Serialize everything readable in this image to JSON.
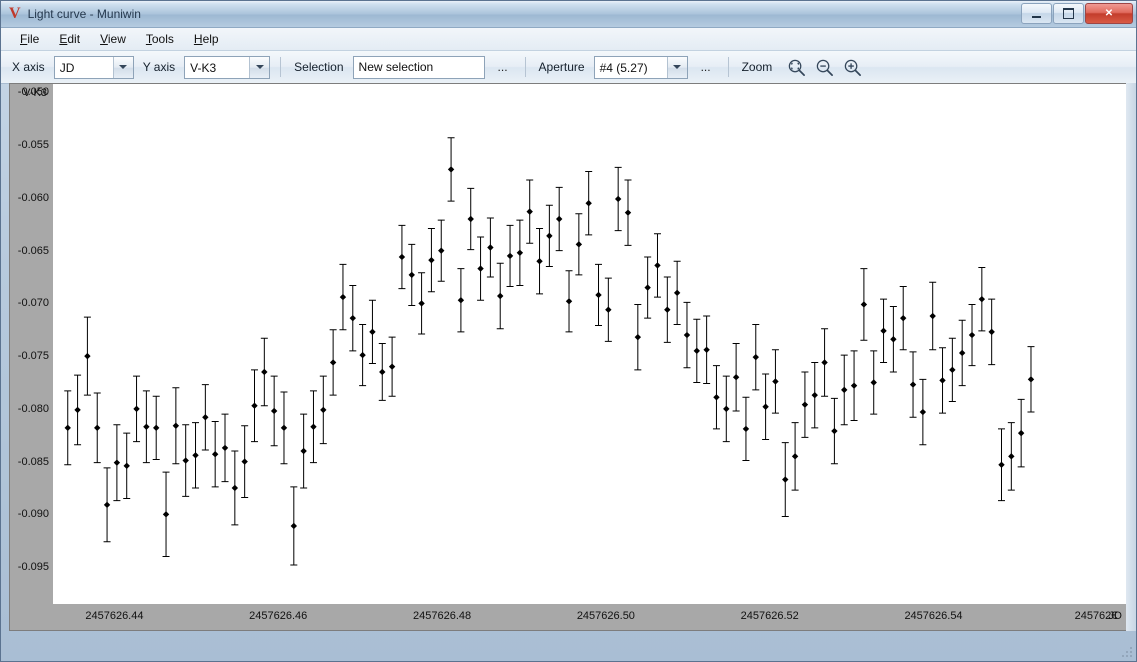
{
  "window": {
    "title": "Light curve - Muniwin",
    "logo": "V",
    "buttons": {
      "minimize": "minimize-button",
      "maximize": "maximize-button",
      "close": "✕"
    }
  },
  "menu": [
    {
      "label": "File",
      "accel": "F"
    },
    {
      "label": "Edit",
      "accel": "E"
    },
    {
      "label": "View",
      "accel": "V"
    },
    {
      "label": "Tools",
      "accel": "T"
    },
    {
      "label": "Help",
      "accel": "H"
    }
  ],
  "toolbar": {
    "x_axis_label": "X axis",
    "x_axis_value": "JD",
    "y_axis_label": "Y axis",
    "y_axis_value": "V-K3",
    "selection_label": "Selection",
    "selection_value": "New selection",
    "selection_more": "...",
    "aperture_label": "Aperture",
    "aperture_value": "#4 (5.27)",
    "aperture_more": "...",
    "zoom_label": "Zoom",
    "zoom_fit_icon": "zoom-fit-icon",
    "zoom_out_icon": "zoom-out-icon",
    "zoom_in_icon": "zoom-in-icon"
  },
  "chart_data": {
    "type": "scatter",
    "title": "",
    "xlabel": "JD",
    "ylabel": "V-K3",
    "grid": false,
    "legend": null,
    "xlim": [
      2457626.4325,
      2457626.5635
    ],
    "ylim": [
      -0.0985,
      -0.0492
    ],
    "y_axis_corner_label": "V-K3",
    "yticks": [
      -0.095,
      -0.09,
      -0.085,
      -0.08,
      -0.075,
      -0.07,
      -0.065,
      -0.06,
      -0.055,
      -0.05
    ],
    "ytick_labels": [
      "-0.095",
      "-0.090",
      "-0.085",
      "-0.080",
      "-0.075",
      "-0.070",
      "-0.065",
      "-0.060",
      "-0.055",
      "-0.050"
    ],
    "xticks": [
      2457626.44,
      2457626.46,
      2457626.48,
      2457626.5,
      2457626.52,
      2457626.54,
      2457626.56
    ],
    "xtick_labels": [
      "2457626.44",
      "2457626.46",
      "2457626.48",
      "2457626.50",
      "2457626.52",
      "2457626.54",
      "245762€"
    ],
    "marker": "diamond",
    "marker_color": "#000000",
    "errorbar_color": "#000000",
    "y_inverted": false,
    "points": [
      {
        "x": 2457626.4343,
        "y": -0.0818,
        "err": 0.0035
      },
      {
        "x": 2457626.4355,
        "y": -0.0801,
        "err": 0.0033
      },
      {
        "x": 2457626.4367,
        "y": -0.075,
        "err": 0.0037
      },
      {
        "x": 2457626.4379,
        "y": -0.0818,
        "err": 0.0033
      },
      {
        "x": 2457626.4391,
        "y": -0.0891,
        "err": 0.0035
      },
      {
        "x": 2457626.4403,
        "y": -0.0851,
        "err": 0.0036
      },
      {
        "x": 2457626.4415,
        "y": -0.0854,
        "err": 0.0031
      },
      {
        "x": 2457626.4427,
        "y": -0.08,
        "err": 0.0031
      },
      {
        "x": 2457626.4439,
        "y": -0.0817,
        "err": 0.0034
      },
      {
        "x": 2457626.4451,
        "y": -0.0818,
        "err": 0.003
      },
      {
        "x": 2457626.4463,
        "y": -0.09,
        "err": 0.004
      },
      {
        "x": 2457626.4475,
        "y": -0.0816,
        "err": 0.0036
      },
      {
        "x": 2457626.4487,
        "y": -0.0849,
        "err": 0.0034
      },
      {
        "x": 2457626.4499,
        "y": -0.0844,
        "err": 0.0031
      },
      {
        "x": 2457626.4511,
        "y": -0.0808,
        "err": 0.0031
      },
      {
        "x": 2457626.4523,
        "y": -0.0843,
        "err": 0.0031
      },
      {
        "x": 2457626.4535,
        "y": -0.0837,
        "err": 0.0032
      },
      {
        "x": 2457626.4547,
        "y": -0.0875,
        "err": 0.0035
      },
      {
        "x": 2457626.4559,
        "y": -0.085,
        "err": 0.0034
      },
      {
        "x": 2457626.4571,
        "y": -0.0797,
        "err": 0.0034
      },
      {
        "x": 2457626.4583,
        "y": -0.0765,
        "err": 0.0032
      },
      {
        "x": 2457626.4595,
        "y": -0.0802,
        "err": 0.0033
      },
      {
        "x": 2457626.4607,
        "y": -0.0818,
        "err": 0.0034
      },
      {
        "x": 2457626.4619,
        "y": -0.0911,
        "err": 0.0037
      },
      {
        "x": 2457626.4631,
        "y": -0.084,
        "err": 0.0035
      },
      {
        "x": 2457626.4643,
        "y": -0.0817,
        "err": 0.0034
      },
      {
        "x": 2457626.4655,
        "y": -0.0801,
        "err": 0.0032
      },
      {
        "x": 2457626.4667,
        "y": -0.0756,
        "err": 0.0031
      },
      {
        "x": 2457626.4679,
        "y": -0.0694,
        "err": 0.0031
      },
      {
        "x": 2457626.4691,
        "y": -0.0714,
        "err": 0.0031
      },
      {
        "x": 2457626.4703,
        "y": -0.0749,
        "err": 0.0029
      },
      {
        "x": 2457626.4715,
        "y": -0.0727,
        "err": 0.003
      },
      {
        "x": 2457626.4727,
        "y": -0.0765,
        "err": 0.0027
      },
      {
        "x": 2457626.4739,
        "y": -0.076,
        "err": 0.0028
      },
      {
        "x": 2457626.4751,
        "y": -0.0656,
        "err": 0.003
      },
      {
        "x": 2457626.4763,
        "y": -0.0673,
        "err": 0.0029
      },
      {
        "x": 2457626.4775,
        "y": -0.07,
        "err": 0.0029
      },
      {
        "x": 2457626.4787,
        "y": -0.0659,
        "err": 0.003
      },
      {
        "x": 2457626.4799,
        "y": -0.065,
        "err": 0.0029
      },
      {
        "x": 2457626.4811,
        "y": -0.0573,
        "err": 0.003
      },
      {
        "x": 2457626.4823,
        "y": -0.0697,
        "err": 0.003
      },
      {
        "x": 2457626.4835,
        "y": -0.062,
        "err": 0.0029
      },
      {
        "x": 2457626.4847,
        "y": -0.0667,
        "err": 0.003
      },
      {
        "x": 2457626.4859,
        "y": -0.0647,
        "err": 0.0028
      },
      {
        "x": 2457626.4871,
        "y": -0.0693,
        "err": 0.0031
      },
      {
        "x": 2457626.4883,
        "y": -0.0655,
        "err": 0.0029
      },
      {
        "x": 2457626.4895,
        "y": -0.0652,
        "err": 0.0031
      },
      {
        "x": 2457626.4907,
        "y": -0.0613,
        "err": 0.003
      },
      {
        "x": 2457626.4919,
        "y": -0.066,
        "err": 0.0031
      },
      {
        "x": 2457626.4931,
        "y": -0.0636,
        "err": 0.0029
      },
      {
        "x": 2457626.4943,
        "y": -0.062,
        "err": 0.003
      },
      {
        "x": 2457626.4955,
        "y": -0.0698,
        "err": 0.0029
      },
      {
        "x": 2457626.4967,
        "y": -0.0644,
        "err": 0.0029
      },
      {
        "x": 2457626.4979,
        "y": -0.0605,
        "err": 0.003
      },
      {
        "x": 2457626.4991,
        "y": -0.0692,
        "err": 0.0029
      },
      {
        "x": 2457626.5003,
        "y": -0.0706,
        "err": 0.003
      },
      {
        "x": 2457626.5015,
        "y": -0.0601,
        "err": 0.003
      },
      {
        "x": 2457626.5027,
        "y": -0.0614,
        "err": 0.0031
      },
      {
        "x": 2457626.5039,
        "y": -0.0732,
        "err": 0.0031
      },
      {
        "x": 2457626.5051,
        "y": -0.0685,
        "err": 0.0029
      },
      {
        "x": 2457626.5063,
        "y": -0.0664,
        "err": 0.003
      },
      {
        "x": 2457626.5075,
        "y": -0.0706,
        "err": 0.0031
      },
      {
        "x": 2457626.5087,
        "y": -0.069,
        "err": 0.003
      },
      {
        "x": 2457626.5099,
        "y": -0.073,
        "err": 0.0031
      },
      {
        "x": 2457626.5111,
        "y": -0.0745,
        "err": 0.003
      },
      {
        "x": 2457626.5123,
        "y": -0.0744,
        "err": 0.0032
      },
      {
        "x": 2457626.5135,
        "y": -0.0789,
        "err": 0.003
      },
      {
        "x": 2457626.5147,
        "y": -0.08,
        "err": 0.0031
      },
      {
        "x": 2457626.5159,
        "y": -0.077,
        "err": 0.0032
      },
      {
        "x": 2457626.5171,
        "y": -0.0819,
        "err": 0.003
      },
      {
        "x": 2457626.5183,
        "y": -0.0751,
        "err": 0.0031
      },
      {
        "x": 2457626.5195,
        "y": -0.0798,
        "err": 0.0031
      },
      {
        "x": 2457626.5207,
        "y": -0.0774,
        "err": 0.003
      },
      {
        "x": 2457626.5219,
        "y": -0.0867,
        "err": 0.0035
      },
      {
        "x": 2457626.5231,
        "y": -0.0845,
        "err": 0.0032
      },
      {
        "x": 2457626.5243,
        "y": -0.0796,
        "err": 0.0031
      },
      {
        "x": 2457626.5255,
        "y": -0.0787,
        "err": 0.0031
      },
      {
        "x": 2457626.5267,
        "y": -0.0756,
        "err": 0.0032
      },
      {
        "x": 2457626.5279,
        "y": -0.0821,
        "err": 0.0031
      },
      {
        "x": 2457626.5291,
        "y": -0.0782,
        "err": 0.0033
      },
      {
        "x": 2457626.5303,
        "y": -0.0778,
        "err": 0.0033
      },
      {
        "x": 2457626.5315,
        "y": -0.0701,
        "err": 0.0034
      },
      {
        "x": 2457626.5327,
        "y": -0.0775,
        "err": 0.003
      },
      {
        "x": 2457626.5339,
        "y": -0.0726,
        "err": 0.003
      },
      {
        "x": 2457626.5351,
        "y": -0.0734,
        "err": 0.0031
      },
      {
        "x": 2457626.5363,
        "y": -0.0714,
        "err": 0.003
      },
      {
        "x": 2457626.5375,
        "y": -0.0777,
        "err": 0.0031
      },
      {
        "x": 2457626.5387,
        "y": -0.0803,
        "err": 0.0031
      },
      {
        "x": 2457626.5399,
        "y": -0.0712,
        "err": 0.0032
      },
      {
        "x": 2457626.5411,
        "y": -0.0773,
        "err": 0.0031
      },
      {
        "x": 2457626.5423,
        "y": -0.0763,
        "err": 0.003
      },
      {
        "x": 2457626.5435,
        "y": -0.0747,
        "err": 0.0031
      },
      {
        "x": 2457626.5447,
        "y": -0.073,
        "err": 0.0029
      },
      {
        "x": 2457626.5459,
        "y": -0.0696,
        "err": 0.003
      },
      {
        "x": 2457626.5471,
        "y": -0.0727,
        "err": 0.0031
      },
      {
        "x": 2457626.5483,
        "y": -0.0853,
        "err": 0.0034
      },
      {
        "x": 2457626.5495,
        "y": -0.0845,
        "err": 0.0032
      },
      {
        "x": 2457626.5507,
        "y": -0.0823,
        "err": 0.0032
      },
      {
        "x": 2457626.5519,
        "y": -0.0772,
        "err": 0.0031
      }
    ]
  }
}
